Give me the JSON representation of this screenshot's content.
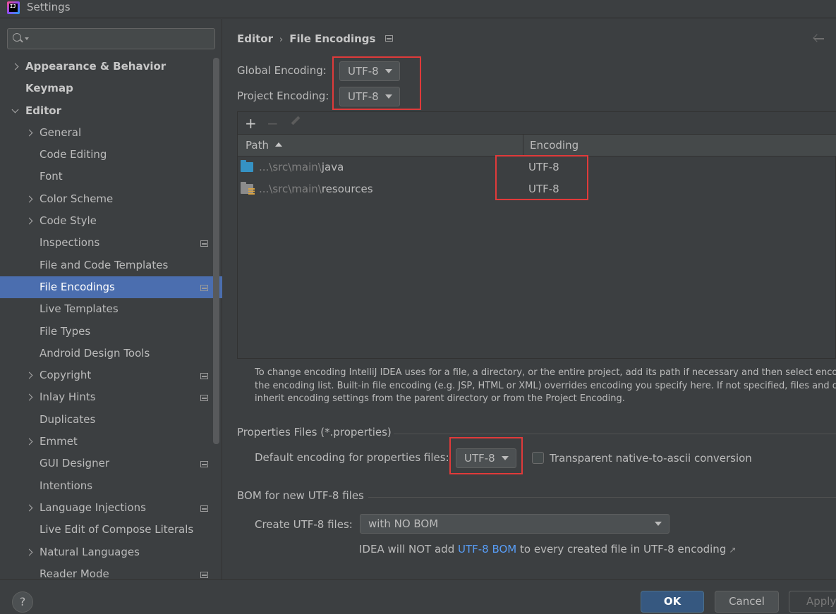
{
  "window": {
    "title": "Settings"
  },
  "sidebar": {
    "search": {
      "placeholder": ""
    },
    "items": [
      {
        "label": "Appearance & Behavior",
        "level": 0,
        "expandable": true,
        "expanded": false,
        "bold": true,
        "project_icon": false,
        "selected": false
      },
      {
        "label": "Keymap",
        "level": 0,
        "expandable": false,
        "bold": true,
        "project_icon": false,
        "selected": false
      },
      {
        "label": "Editor",
        "level": 0,
        "expandable": true,
        "expanded": true,
        "bold": true,
        "project_icon": false,
        "selected": false
      },
      {
        "label": "General",
        "level": 1,
        "expandable": true,
        "project_icon": false,
        "selected": false
      },
      {
        "label": "Code Editing",
        "level": 1,
        "expandable": false,
        "project_icon": false,
        "selected": false
      },
      {
        "label": "Font",
        "level": 1,
        "expandable": false,
        "project_icon": false,
        "selected": false
      },
      {
        "label": "Color Scheme",
        "level": 1,
        "expandable": true,
        "project_icon": false,
        "selected": false
      },
      {
        "label": "Code Style",
        "level": 1,
        "expandable": true,
        "project_icon": false,
        "selected": false
      },
      {
        "label": "Inspections",
        "level": 1,
        "expandable": false,
        "project_icon": true,
        "selected": false
      },
      {
        "label": "File and Code Templates",
        "level": 1,
        "expandable": false,
        "project_icon": false,
        "selected": false
      },
      {
        "label": "File Encodings",
        "level": 1,
        "expandable": false,
        "project_icon": true,
        "selected": true
      },
      {
        "label": "Live Templates",
        "level": 1,
        "expandable": false,
        "project_icon": false,
        "selected": false
      },
      {
        "label": "File Types",
        "level": 1,
        "expandable": false,
        "project_icon": false,
        "selected": false
      },
      {
        "label": "Android Design Tools",
        "level": 1,
        "expandable": false,
        "project_icon": false,
        "selected": false
      },
      {
        "label": "Copyright",
        "level": 1,
        "expandable": true,
        "project_icon": true,
        "selected": false
      },
      {
        "label": "Inlay Hints",
        "level": 1,
        "expandable": true,
        "project_icon": true,
        "selected": false
      },
      {
        "label": "Duplicates",
        "level": 1,
        "expandable": false,
        "project_icon": false,
        "selected": false
      },
      {
        "label": "Emmet",
        "level": 1,
        "expandable": true,
        "project_icon": false,
        "selected": false
      },
      {
        "label": "GUI Designer",
        "level": 1,
        "expandable": false,
        "project_icon": true,
        "selected": false
      },
      {
        "label": "Intentions",
        "level": 1,
        "expandable": false,
        "project_icon": false,
        "selected": false
      },
      {
        "label": "Language Injections",
        "level": 1,
        "expandable": true,
        "project_icon": true,
        "selected": false
      },
      {
        "label": "Live Edit of Compose Literals",
        "level": 1,
        "expandable": false,
        "project_icon": false,
        "selected": false
      },
      {
        "label": "Natural Languages",
        "level": 1,
        "expandable": true,
        "project_icon": false,
        "selected": false
      },
      {
        "label": "Reader Mode",
        "level": 1,
        "expandable": false,
        "project_icon": true,
        "selected": false
      }
    ]
  },
  "breadcrumb": {
    "parent": "Editor",
    "separator": "›",
    "current": "File Encodings"
  },
  "encoding": {
    "global_label": "Global Encoding:",
    "global_value": "UTF-8",
    "project_label": "Project Encoding:",
    "project_value": "UTF-8"
  },
  "table": {
    "toolbar": {
      "add": "+",
      "remove": "−"
    },
    "headers": {
      "path": "Path",
      "encoding": "Encoding"
    },
    "rows": [
      {
        "path_prefix": "...\\src\\main\\",
        "path_name": "java",
        "encoding": "UTF-8",
        "icon": "source-folder-icon"
      },
      {
        "path_prefix": "...\\src\\main\\",
        "path_name": "resources",
        "encoding": "UTF-8",
        "icon": "resources-folder-icon"
      }
    ]
  },
  "help": {
    "line1": "To change encoding IntelliJ IDEA uses for a file, a directory, or the entire project, add its path if necessary and then select encoding from",
    "line2": "the encoding list. Built-in file encoding (e.g. JSP, HTML or XML) overrides encoding you specify here. If not specified, files and directories",
    "line3": "inherit encoding settings from the parent directory or from the Project Encoding."
  },
  "properties": {
    "section_title": "Properties Files (*.properties)",
    "default_label": "Default encoding for properties files:",
    "default_value": "UTF-8",
    "transparent_label": "Transparent native-to-ascii conversion",
    "transparent_checked": false
  },
  "bom": {
    "section_title": "BOM for new UTF-8 files",
    "create_label": "Create UTF-8 files:",
    "create_value": "with NO BOM",
    "note_before": "IDEA will NOT add ",
    "note_link": "UTF-8 BOM",
    "note_after": " to every created file in UTF-8 encoding"
  },
  "buttons": {
    "help": "?",
    "ok": "OK",
    "cancel": "Cancel",
    "apply": "Apply"
  },
  "colors": {
    "accent": "#4b6eaf",
    "highlight": "#e03a3a",
    "link": "#589df6",
    "background": "#3c3f41"
  }
}
